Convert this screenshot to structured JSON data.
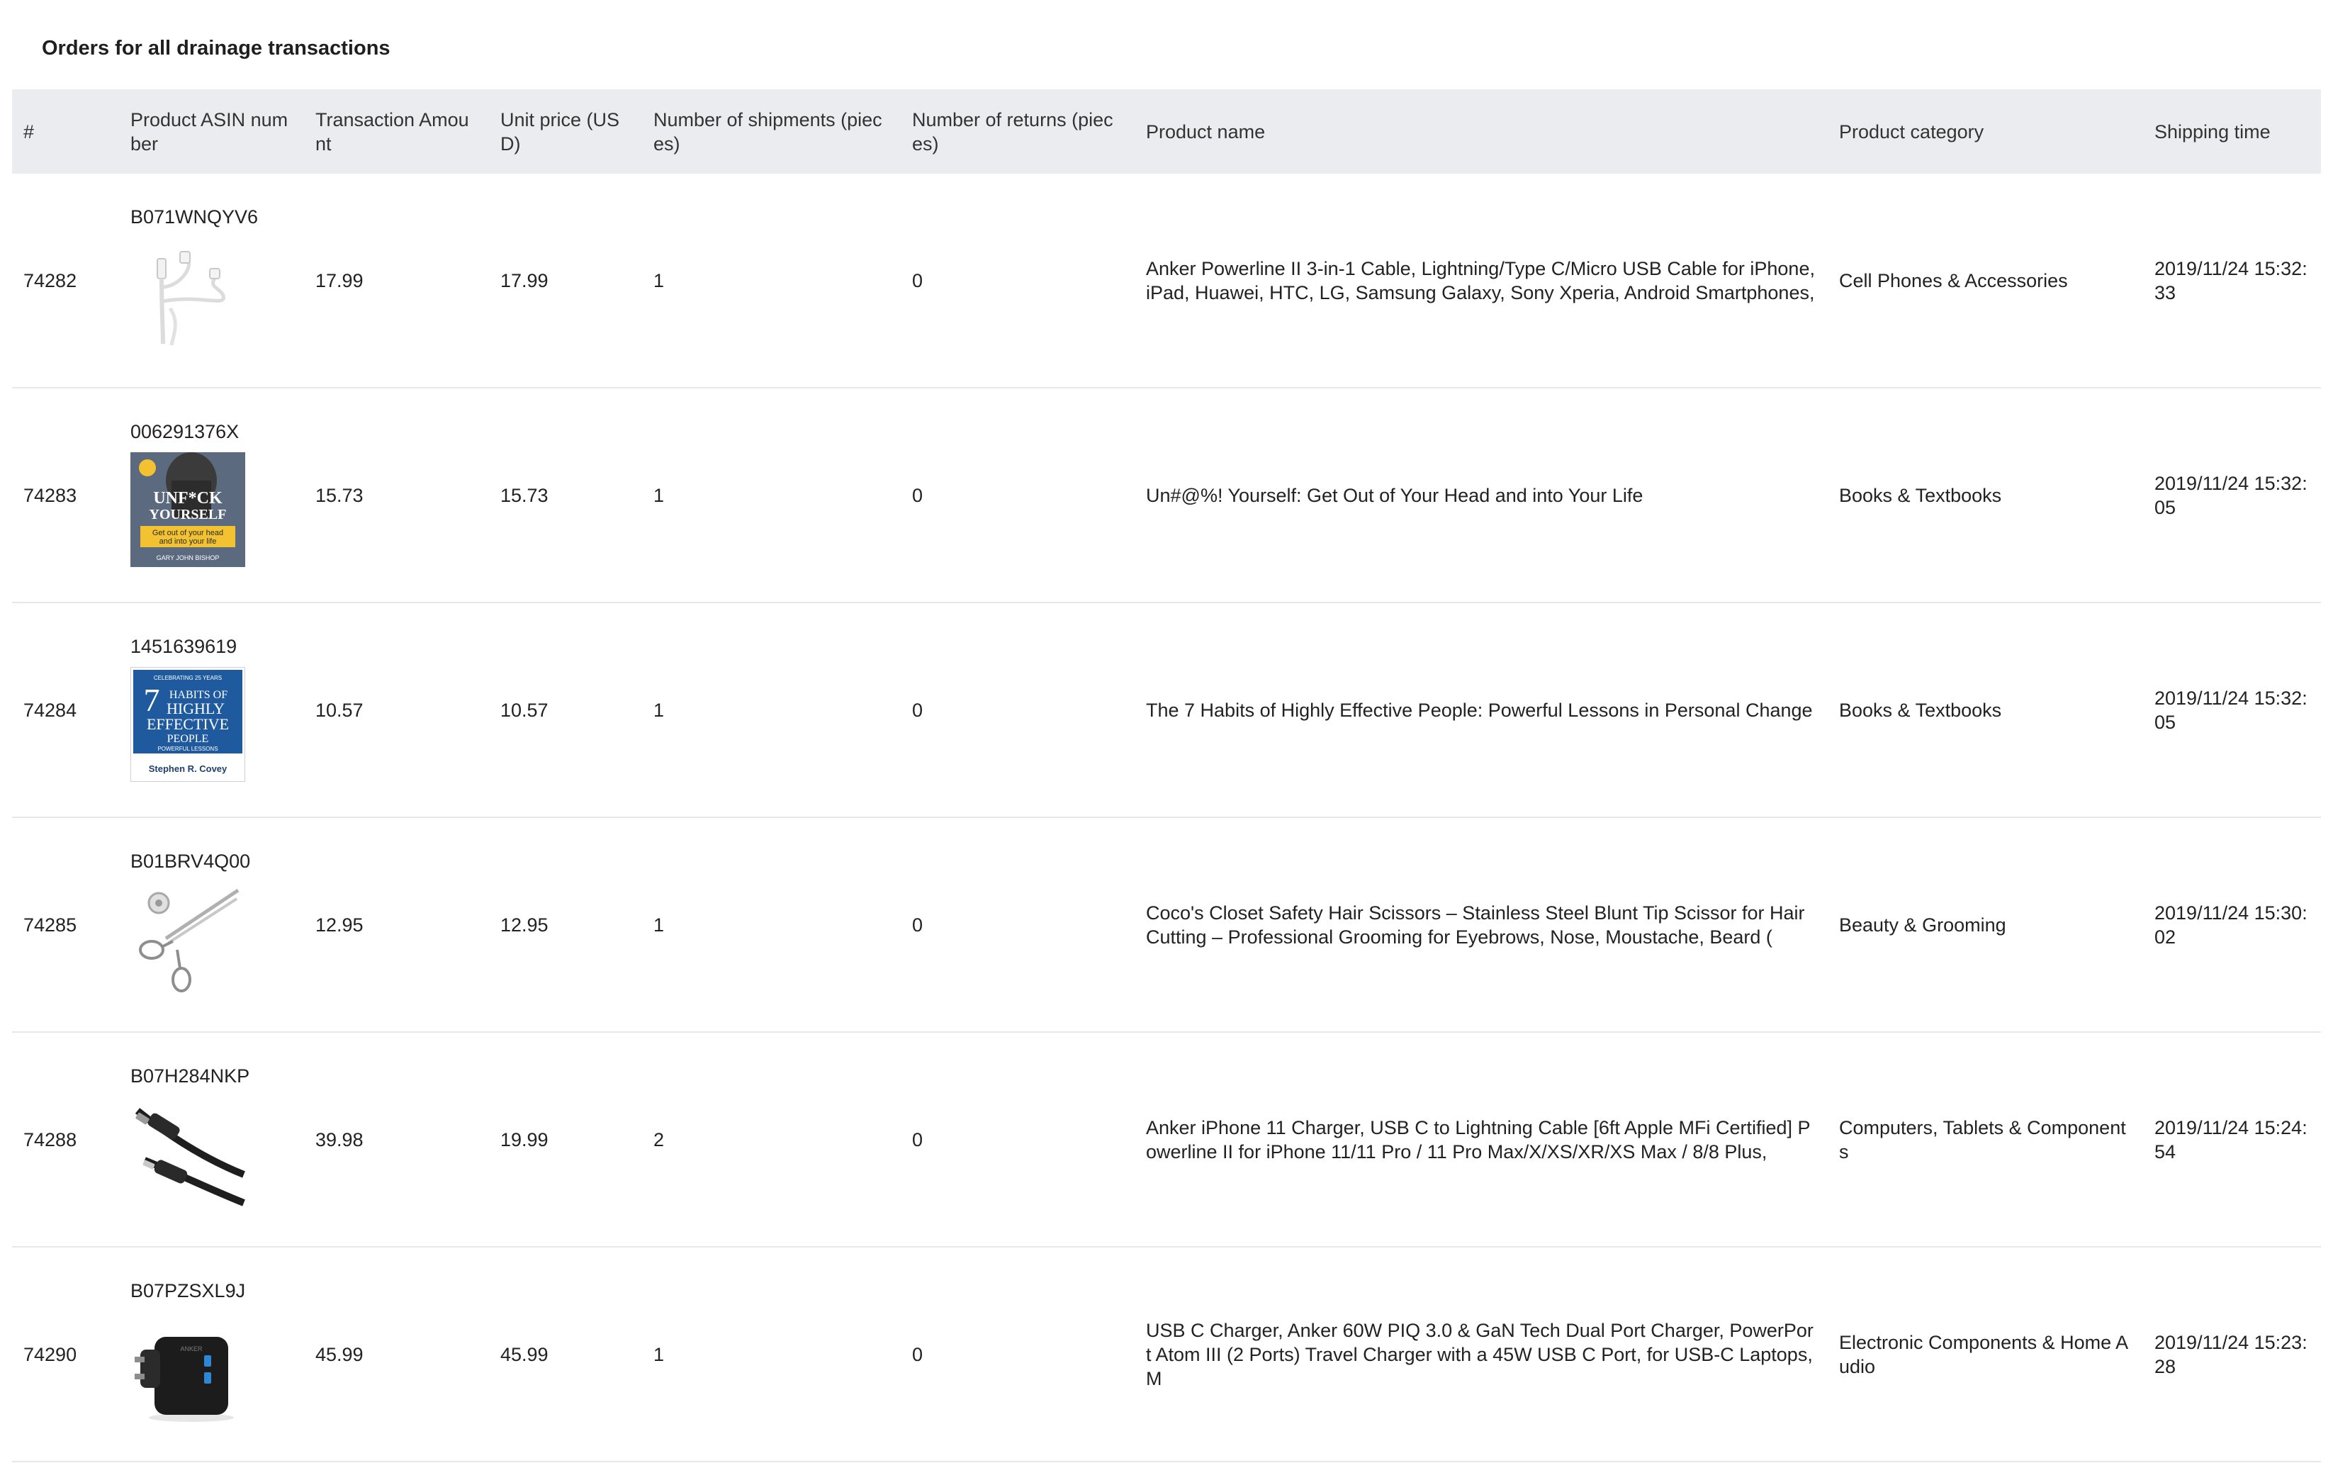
{
  "page": {
    "title": "Orders for all drainage transactions"
  },
  "table": {
    "columns": [
      "#",
      "Product ASIN number",
      "Transaction Amount",
      "Unit price (USD)",
      "Number of shipments (pieces)",
      "Number of returns (pieces)",
      "Product name",
      "Product category",
      "Shipping time"
    ],
    "rows": [
      {
        "id": "74282",
        "asin": "B071WNQYV6",
        "image": "usb-cable-3in1-thumbnail",
        "amount": "17.99",
        "unit_price": "17.99",
        "shipments": "1",
        "returns": "0",
        "name": "Anker Powerline II 3-in-1 Cable, Lightning/Type C/Micro USB Cable for iPhone, iPad, Huawei, HTC, LG, Samsung Galaxy, Sony Xperia, Android Smartphones,",
        "category": "Cell Phones & Accessories",
        "time": "2019/11/24 15:32:33"
      },
      {
        "id": "74283",
        "asin": "006291376X",
        "image": "book-cover-unfck-yourself",
        "amount": "15.73",
        "unit_price": "15.73",
        "shipments": "1",
        "returns": "0",
        "name": "Un#@%! Yourself: Get Out of Your Head and into Your Life",
        "category": "Books & Textbooks",
        "time": "2019/11/24 15:32:05"
      },
      {
        "id": "74284",
        "asin": "1451639619",
        "image": "book-cover-7-habits",
        "amount": "10.57",
        "unit_price": "10.57",
        "shipments": "1",
        "returns": "0",
        "name": "The 7 Habits of Highly Effective People: Powerful Lessons in Personal Change",
        "category": "Books & Textbooks",
        "time": "2019/11/24 15:32:05"
      },
      {
        "id": "74285",
        "asin": "B01BRV4Q00",
        "image": "scissors-thumbnail",
        "amount": "12.95",
        "unit_price": "12.95",
        "shipments": "1",
        "returns": "0",
        "name": "Coco's Closet Safety Hair Scissors – Stainless Steel Blunt Tip Scissor for Hair Cutting – Professional Grooming for Eyebrows, Nose, Moustache, Beard (",
        "category": "Beauty & Grooming",
        "time": "2019/11/24 15:30:02"
      },
      {
        "id": "74288",
        "asin": "B07H284NKP",
        "image": "usb-c-lightning-cable-thumbnail",
        "amount": "39.98",
        "unit_price": "19.99",
        "shipments": "2",
        "returns": "0",
        "name": "Anker iPhone 11 Charger, USB C to Lightning Cable [6ft Apple MFi Certified] Powerline II for iPhone 11/11 Pro / 11 Pro Max/X/XS/XR/XS Max / 8/8 Plus,",
        "category": "Computers, Tablets & Components",
        "time": "2019/11/24 15:24:54"
      },
      {
        "id": "74290",
        "asin": "B07PZSXL9J",
        "image": "wall-charger-thumbnail",
        "amount": "45.99",
        "unit_price": "45.99",
        "shipments": "1",
        "returns": "0",
        "name": "USB C Charger, Anker 60W PIQ 3.0 & GaN Tech Dual Port Charger, PowerPort Atom III (2 Ports) Travel Charger with a 45W USB C Port, for USB-C Laptops, M",
        "category": "Electronic Components & Home Audio",
        "time": "2019/11/24 15:23:28"
      }
    ]
  },
  "thumbnails": {
    "book1": {
      "title_line1": "UNF*CK",
      "title_line2": "YOURSELF",
      "subtitle_line1": "Get out of your head",
      "subtitle_line2": "and into your life",
      "author": "GARY JOHN BISHOP",
      "color": "#5c6a80",
      "band_color": "#f2c230"
    },
    "book2": {
      "top_line": "CELEBRATING 25 YEARS",
      "seven": "7",
      "line1": "HABITS OF",
      "line2": "HIGHLY",
      "line3": "EFFECTIVE",
      "line4": "PEOPLE",
      "tagline": "POWERFUL LESSONS",
      "author": "Stephen R. Covey",
      "color": "#1f5a9e"
    },
    "charger": {
      "brand": "ANKER"
    }
  }
}
